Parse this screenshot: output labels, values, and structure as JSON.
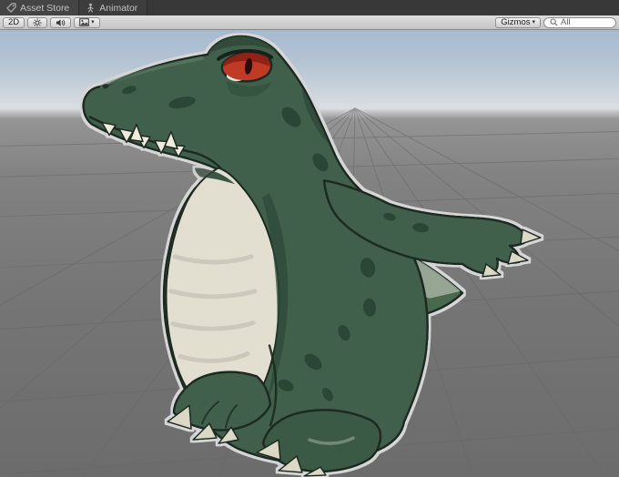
{
  "tabs": {
    "asset_store": "Asset Store",
    "animator": "Animator"
  },
  "scene_toolbar": {
    "mode_2d": "2D",
    "gizmos": "Gizmos",
    "search_value": "All"
  },
  "colors": {
    "croc_green": "#41614b",
    "croc_green_dark": "#2c4634",
    "croc_belly": "#e2dfd1",
    "croc_claw": "#dcd8c6",
    "eye_red": "#c03a28",
    "sky_top": "#a6bad0",
    "ground_gray": "#7a7a7a"
  }
}
